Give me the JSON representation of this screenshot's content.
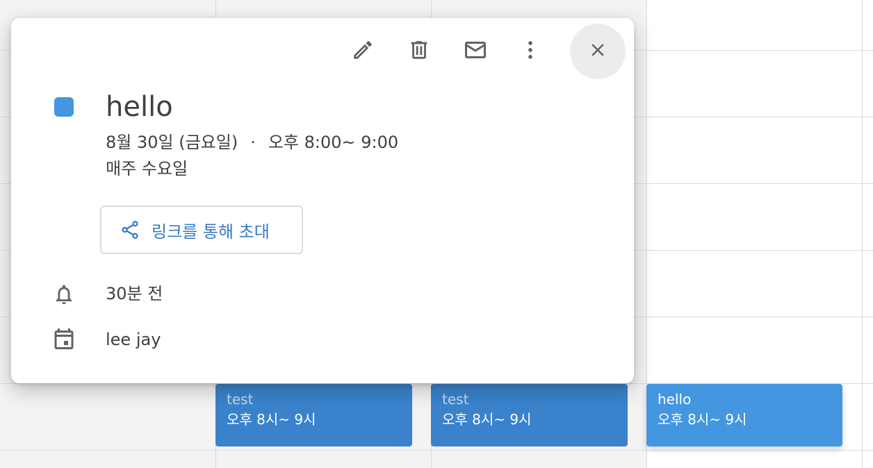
{
  "colors": {
    "event_color": "#4496e0",
    "chip_dim": "#3a83cc",
    "accent_text": "#3478c6",
    "icon_gray": "#5f6368"
  },
  "toolbar": {
    "edit_icon": "pencil-icon",
    "delete_icon": "trash-icon",
    "email_icon": "mail-icon",
    "more_icon": "more-vert-icon",
    "close_icon": "close-icon"
  },
  "event": {
    "title": "hello",
    "date": "8월 30일 (금요일)",
    "separator": "·",
    "time": "오후 8:00~ 9:00",
    "recurrence": "매주 수요일",
    "invite_label": "링크를 통해 초대",
    "reminder": "30분 전",
    "calendar": "lee jay"
  },
  "calendar_events": [
    {
      "title": "test",
      "time": "오후 8시~ 9시"
    },
    {
      "title": "test",
      "time": "오후 8시~ 9시"
    },
    {
      "title": "hello",
      "time": "오후 8시~ 9시"
    }
  ]
}
